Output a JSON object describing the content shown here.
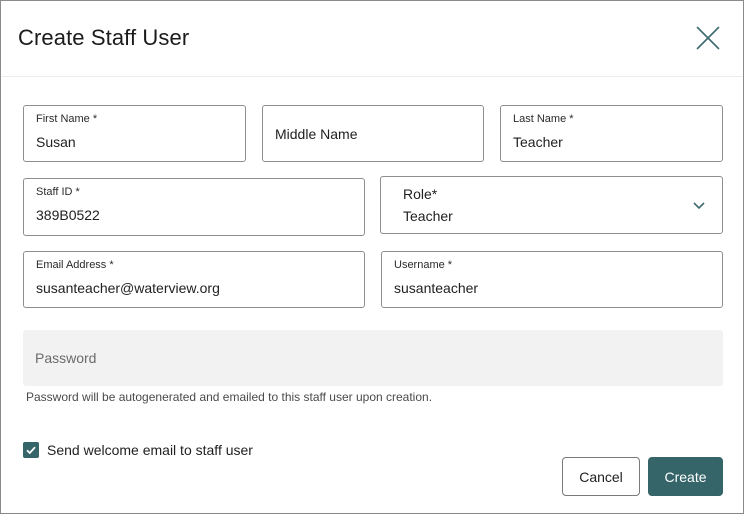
{
  "dialog": {
    "title": "Create Staff User",
    "close_icon": "close-x-icon"
  },
  "fields": {
    "first_name": {
      "label": "First Name *",
      "value": "Susan"
    },
    "middle_name": {
      "placeholder": "Middle Name"
    },
    "last_name": {
      "label": "Last Name *",
      "value": "Teacher"
    },
    "staff_id": {
      "label": "Staff ID *",
      "value": "389B0522"
    },
    "role": {
      "label": "Role*",
      "value": "Teacher",
      "icon": "chevron-down-icon"
    },
    "email": {
      "label": "Email Address *",
      "value": "susanteacher@waterview.org"
    },
    "username": {
      "label": "Username *",
      "value": "susanteacher"
    },
    "password": {
      "placeholder": "Password",
      "helper": "Password will be autogenerated and emailed to this staff user upon creation."
    }
  },
  "welcome_email": {
    "label": "Send welcome email to staff user",
    "checked": true,
    "icon": "checkmark-icon"
  },
  "actions": {
    "cancel_label": "Cancel",
    "create_label": "Create"
  },
  "colors": {
    "accent": "#356469",
    "border": "#8e8e8e",
    "disabled_bg": "#f2f2f2"
  }
}
